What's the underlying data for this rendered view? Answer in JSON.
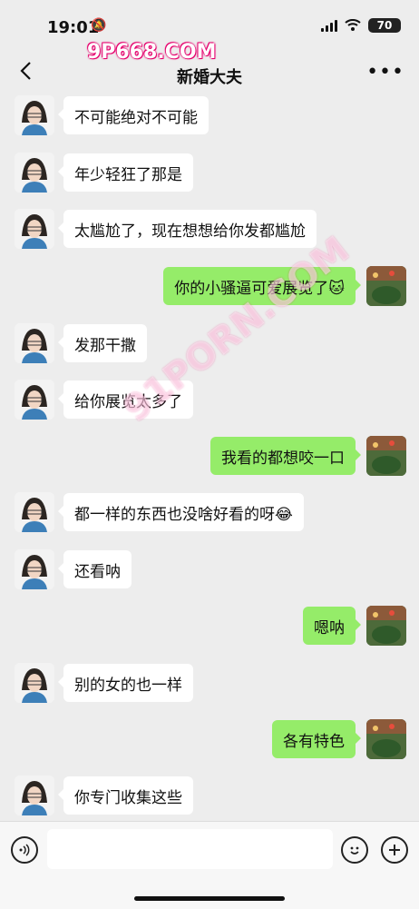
{
  "status": {
    "time": "19:01",
    "battery": "70"
  },
  "header": {
    "title": "新婚大夫",
    "back_icon": "chevron-left-icon",
    "more_icon": "more-dots-icon"
  },
  "watermark": {
    "top": "9P668.COM",
    "diagonal": "91PORN.COM"
  },
  "messages": [
    {
      "side": "left",
      "text": "不可能绝对不可能"
    },
    {
      "side": "left",
      "text": "年少轻狂了那是"
    },
    {
      "side": "left",
      "text": "太尴尬了，现在想想给你发都尴尬"
    },
    {
      "side": "right",
      "text": "你的小骚逼可爱展览了🐱"
    },
    {
      "side": "left",
      "text": "发那干撒"
    },
    {
      "side": "left",
      "text": "给你展览太多了"
    },
    {
      "side": "right",
      "text": "我看的都想咬一口"
    },
    {
      "side": "left",
      "text": "都一样的东西也没啥好看的呀😂"
    },
    {
      "side": "left",
      "text": "还看呐"
    },
    {
      "side": "right",
      "text": "嗯呐"
    },
    {
      "side": "left",
      "text": "别的女的也一样"
    },
    {
      "side": "right",
      "text": "各有特色"
    },
    {
      "side": "left",
      "text": "你专门收集这些"
    }
  ],
  "input": {
    "placeholder": "",
    "voice_icon": "voice-icon",
    "emoji_icon": "emoji-icon",
    "plus_icon": "plus-icon"
  }
}
